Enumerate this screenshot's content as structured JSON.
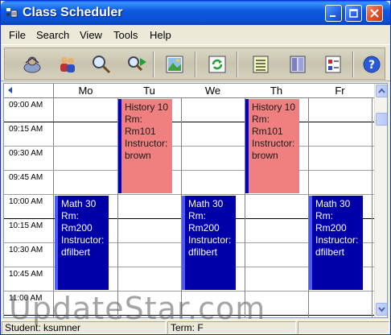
{
  "window": {
    "title": "Class Scheduler",
    "minimize_icon": "minimize-icon",
    "maximize_icon": "maximize-icon",
    "close_icon": "close-icon"
  },
  "menu": {
    "items": [
      "File",
      "Search",
      "View",
      "Tools",
      "Help"
    ]
  },
  "toolbar": {
    "buttons": [
      "students-icon",
      "users-icon",
      "search-icon",
      "search-next-icon",
      "picture-icon",
      "refresh-icon",
      "list-icon",
      "columns-icon",
      "checklist-icon",
      "help-icon"
    ]
  },
  "schedule": {
    "days": [
      "Mo",
      "Tu",
      "We",
      "Th",
      "Fr"
    ],
    "times": [
      "09:00 AM",
      "09:15 AM",
      "09:30 AM",
      "09:45 AM",
      "10:00 AM",
      "10:15 AM",
      "10:30 AM",
      "10:45 AM",
      "11:00 AM"
    ],
    "events": [
      {
        "day": "Tu",
        "start": "09:00 AM",
        "end": "09:45 AM",
        "lines": [
          "History 10",
          "Rm:",
          "Rm101",
          "Instructor:",
          "brown"
        ],
        "color": "#f08080"
      },
      {
        "day": "Th",
        "start": "09:00 AM",
        "end": "09:45 AM",
        "lines": [
          "History 10",
          "Rm:",
          "Rm101",
          "Instructor:",
          "brown"
        ],
        "color": "#f08080"
      },
      {
        "day": "Mo",
        "start": "10:00 AM",
        "end": "10:45 AM",
        "lines": [
          "Math 30",
          "Rm:",
          "Rm200",
          "Instructor:",
          "dfilbert"
        ],
        "color": "#0000a8"
      },
      {
        "day": "We",
        "start": "10:00 AM",
        "end": "10:45 AM",
        "lines": [
          "Math 30",
          "Rm:",
          "Rm200",
          "Instructor:",
          "dfilbert"
        ],
        "color": "#0000a8"
      },
      {
        "day": "Fr",
        "start": "10:00 AM",
        "end": "10:45 AM",
        "lines": [
          "Math 30",
          "Rm:",
          "Rm200",
          "Instructor:",
          "dfilbert"
        ],
        "color": "#0000a8"
      }
    ]
  },
  "status": {
    "student": "Student: ksumner",
    "term": "Term: F"
  },
  "watermark": "UpdateStar.com"
}
